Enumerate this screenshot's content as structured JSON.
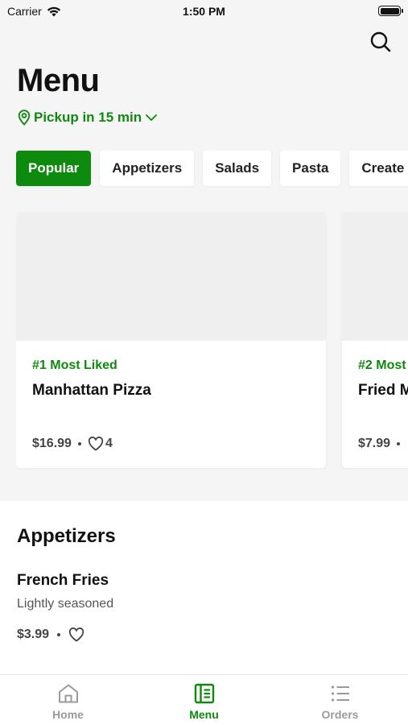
{
  "status_bar": {
    "carrier": "Carrier",
    "time": "1:50 PM"
  },
  "header": {
    "title": "Menu",
    "pickup_label": "Pickup in 15 min",
    "icons": {
      "search": "search-icon",
      "location": "location-pin-icon",
      "chevron": "chevron-down-icon"
    }
  },
  "categories": [
    {
      "label": "Popular",
      "active": true
    },
    {
      "label": "Appetizers",
      "active": false
    },
    {
      "label": "Salads",
      "active": false
    },
    {
      "label": "Pasta",
      "active": false
    },
    {
      "label": "Create",
      "active": false
    }
  ],
  "featured": [
    {
      "rank": "#1 Most Liked",
      "name": "Manhattan Pizza",
      "price": "$16.99",
      "likes": "4"
    },
    {
      "rank": "#2 Most",
      "name": "Fried M",
      "price": "$7.99",
      "likes": ""
    }
  ],
  "section": {
    "title": "Appetizers",
    "items": [
      {
        "name": "French Fries",
        "description": "Lightly seasoned",
        "price": "$3.99"
      }
    ]
  },
  "tabbar": [
    {
      "label": "Home",
      "icon": "home-icon",
      "active": false
    },
    {
      "label": "Menu",
      "icon": "menu-book-icon",
      "active": true
    },
    {
      "label": "Orders",
      "icon": "list-icon",
      "active": false
    }
  ],
  "colors": {
    "accent": "#0e8a0e",
    "background": "#f5f5f5",
    "muted": "#9a9a9a"
  }
}
